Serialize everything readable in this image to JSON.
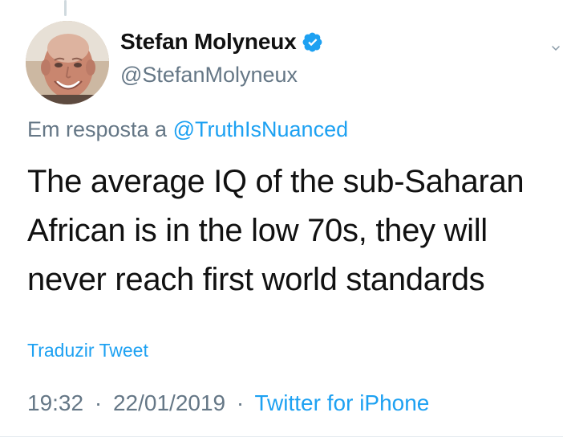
{
  "author": {
    "display_name": "Stefan Molyneux",
    "handle": "@StefanMolyneux",
    "verified": true
  },
  "reply": {
    "prefix": "Em resposta a",
    "to": "@TruthIsNuanced"
  },
  "tweet": {
    "line_1": "The average IQ of the sub-Saharan",
    "line_2": "African is in the low 70s, they will",
    "line_3": "never reach first world standards"
  },
  "actions": {
    "translate": "Traduzir Tweet"
  },
  "meta": {
    "time": "19:32",
    "date": "22/01/2019",
    "separator": "·",
    "source": "Twitter for iPhone"
  },
  "colors": {
    "text_primary": "#111111",
    "text_secondary": "#657786",
    "link_blue": "#1da1f2"
  },
  "icons": {
    "verified": "verified-badge-icon",
    "menu": "chevron-down-icon"
  }
}
